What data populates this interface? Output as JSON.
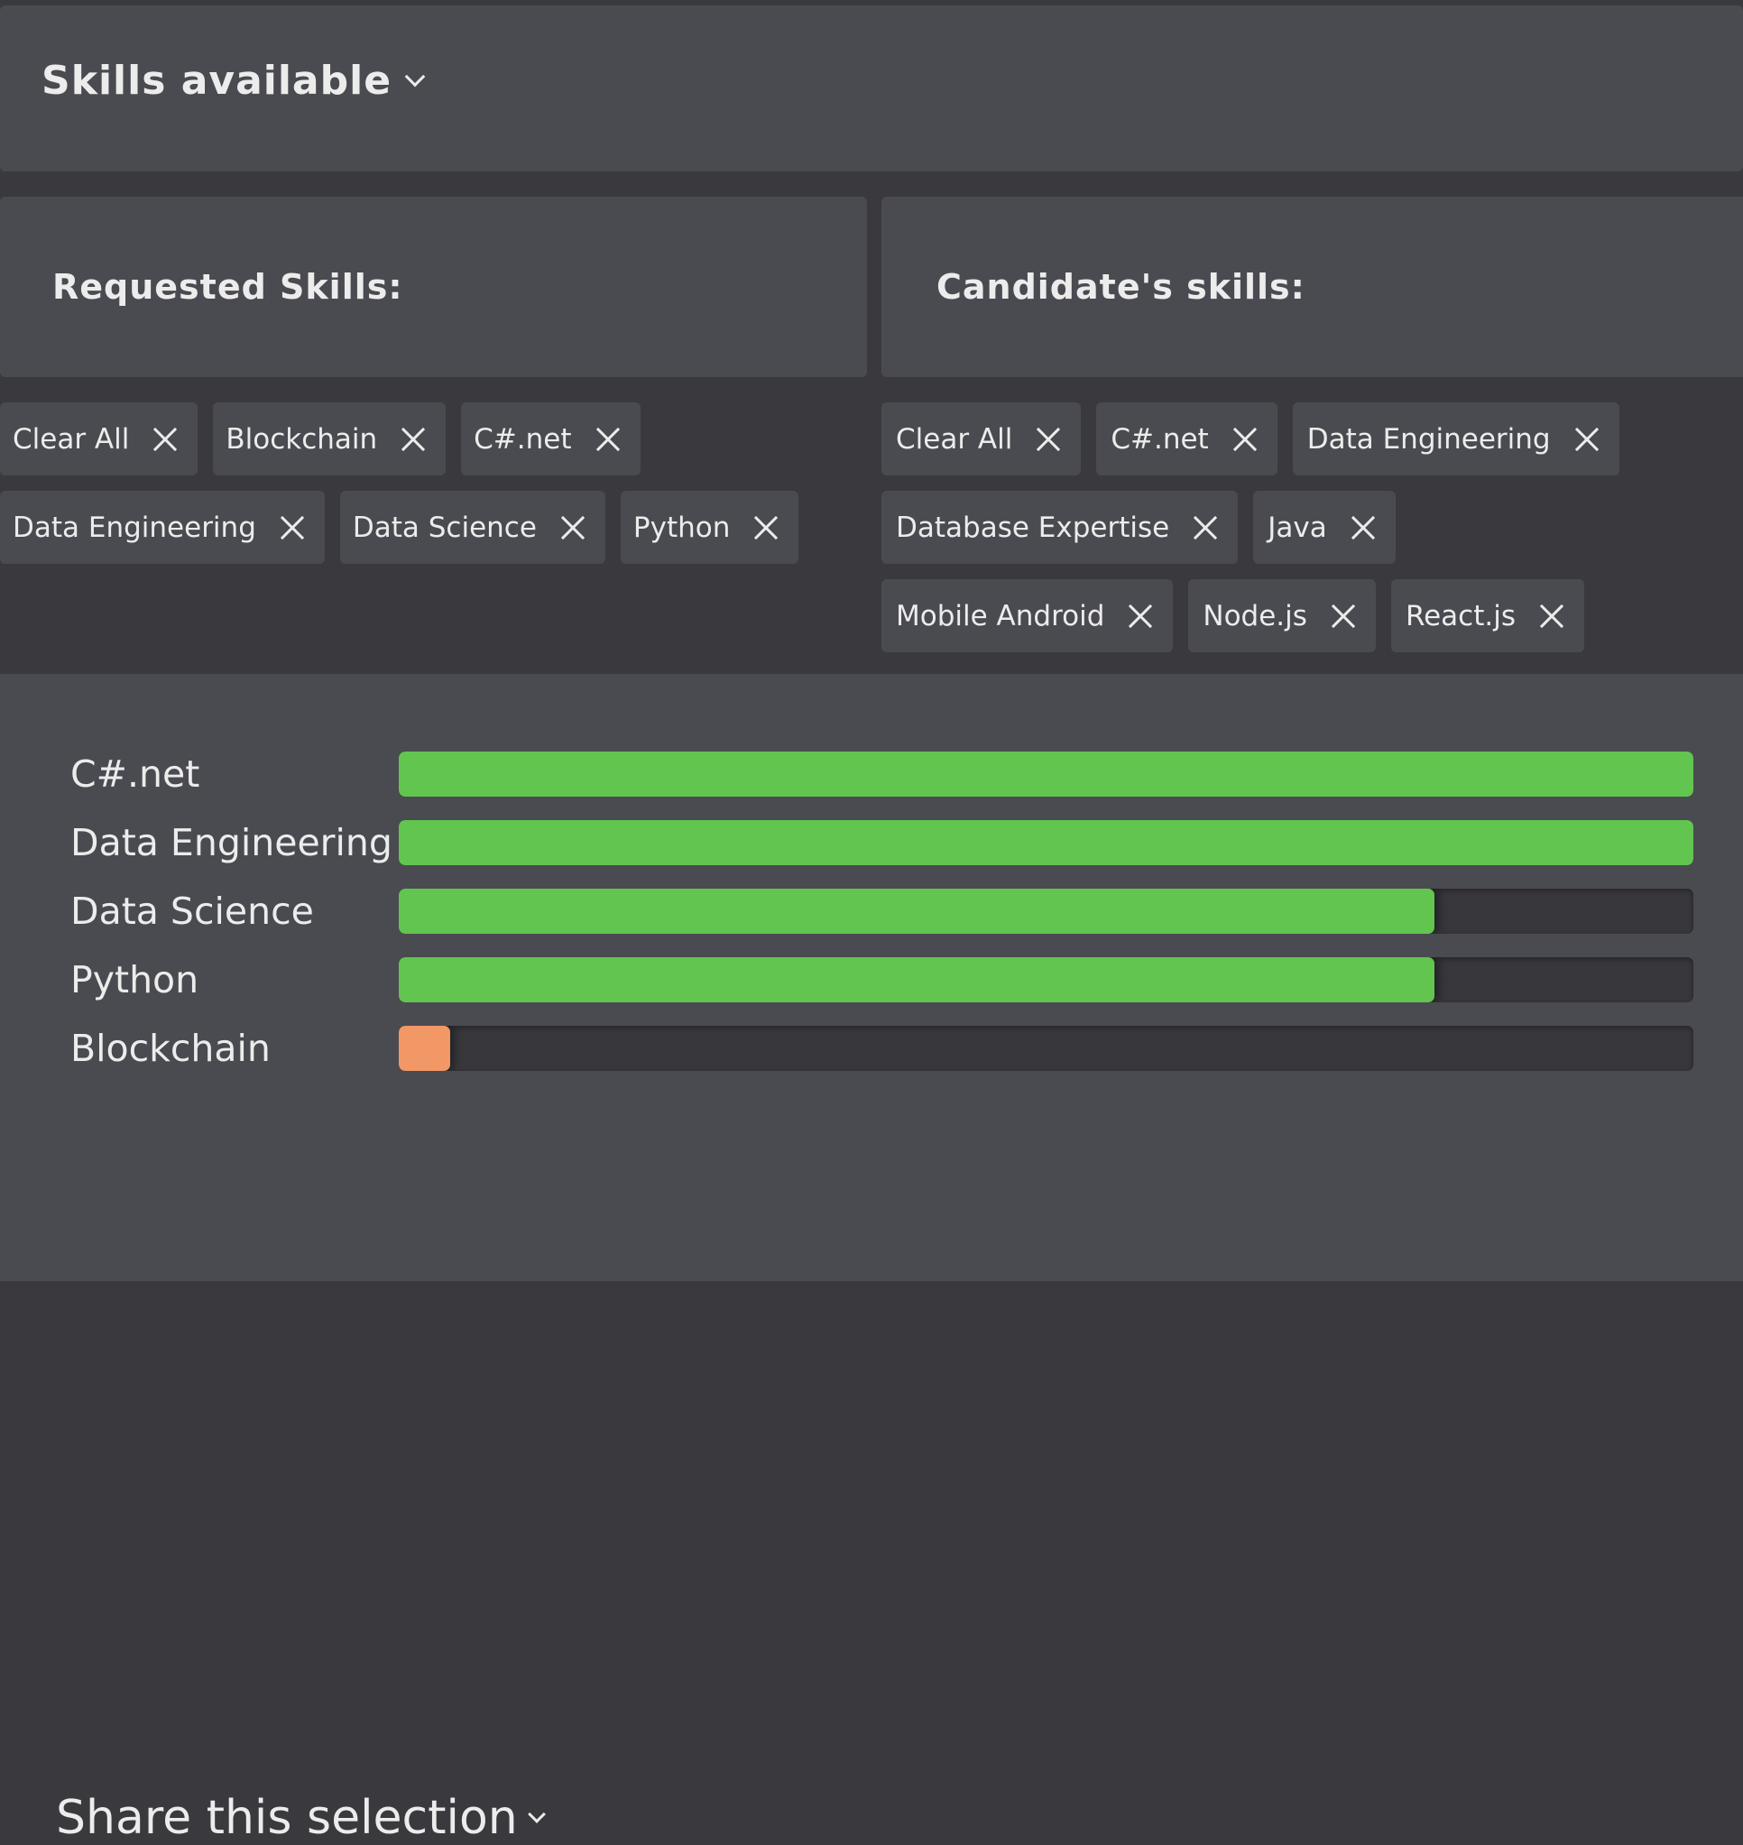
{
  "header": {
    "title": "Skills available",
    "chevron_icon": "chevron-down-icon"
  },
  "requested": {
    "title": "Requested Skills:",
    "chips": [
      "Clear All",
      "Blockchain",
      "C#.net",
      "Data Engineering",
      "Data Science",
      "Python"
    ]
  },
  "candidate": {
    "title": "Candidate's skills:",
    "chips": [
      "Clear All",
      "C#.net",
      "Data Engineering",
      "Database Expertise",
      "Java",
      "Mobile Android",
      "Node.js",
      "React.js"
    ]
  },
  "chip_remove_icon": "close-icon",
  "colors": {
    "match_high": "#61c54f",
    "match_low": "#f29766",
    "track": "#38373c",
    "card": "#4a4b50",
    "background": "#3a393e",
    "text": "#ececec"
  },
  "match_bars": {
    "items": [
      {
        "label": "C#.net",
        "percent": 100,
        "status": "high"
      },
      {
        "label": "Data Engineering",
        "percent": 100,
        "status": "high"
      },
      {
        "label": "Data Science",
        "percent": 80,
        "status": "high"
      },
      {
        "label": "Python",
        "percent": 80,
        "status": "high"
      },
      {
        "label": "Blockchain",
        "percent": 4,
        "status": "low"
      }
    ]
  },
  "share": {
    "label": "Share this selection",
    "chevron_icon": "chevron-down-icon"
  }
}
